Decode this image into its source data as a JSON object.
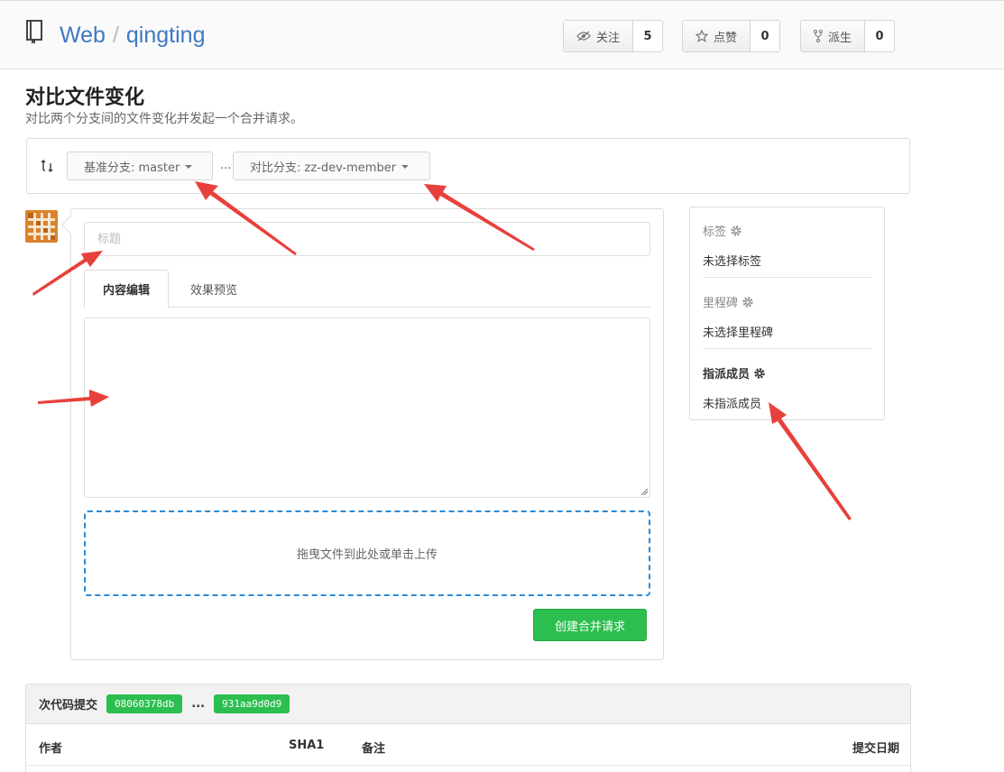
{
  "header": {
    "owner": "Web",
    "separator": "/",
    "repo": "qingting",
    "watch": {
      "label": "关注",
      "count": "5"
    },
    "star": {
      "label": "点赞",
      "count": "0"
    },
    "fork": {
      "label": "派生",
      "count": "0"
    }
  },
  "page": {
    "title": "对比文件变化",
    "subtitle": "对比两个分支间的文件变化并发起一个合并请求。"
  },
  "compare": {
    "base_label": "基准分支: master",
    "head_label": "对比分支: zz-dev-member",
    "dots": "..."
  },
  "form": {
    "title_placeholder": "标题",
    "tabs": [
      {
        "label": "内容编辑",
        "active": true
      },
      {
        "label": "效果预览",
        "active": false
      }
    ],
    "upload_text": "拖曳文件到此处或单击上传",
    "submit_label": "创建合并请求"
  },
  "sidebar": {
    "labels": {
      "title": "标签",
      "value": "未选择标签"
    },
    "milestone": {
      "title": "里程碑",
      "value": "未选择里程碑"
    },
    "assignee": {
      "title": "指派成员",
      "value": "未指派成员"
    }
  },
  "commits": {
    "title": "次代码提交",
    "from_sha": "08060378db",
    "dots": "...",
    "to_sha": "931aa9d0d9",
    "columns": [
      "作者",
      "SHA1",
      "备注",
      "提交日期"
    ]
  },
  "colors": {
    "link": "#4078c0",
    "green": "#2cbe4e",
    "annotation_red": "#e8403c",
    "upload_border": "#2b8ad6"
  }
}
